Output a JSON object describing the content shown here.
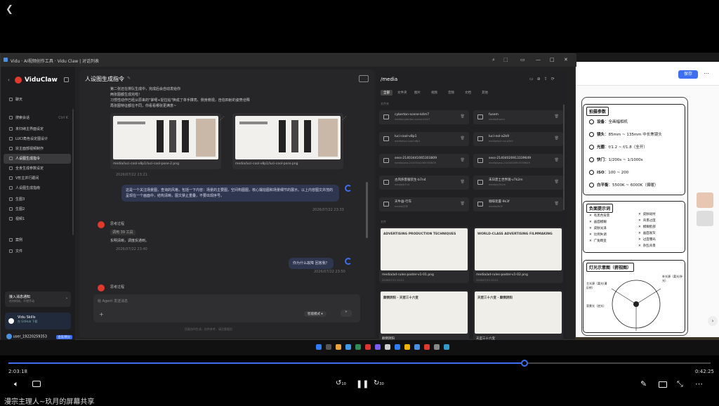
{
  "window": {
    "title": "Vidu · AI视频创作工具 · Vidu Claw | 对话列表"
  },
  "brand": "ViduClaw",
  "sidebar": {
    "items": [
      {
        "label": "聊天",
        "active": false
      },
      {
        "label": "搜索会话",
        "shortcut": "Ctrl K",
        "active": false
      },
      {
        "label": "未归纳主界面设定",
        "active": false
      },
      {
        "label": "LUCI角色设定图设计",
        "active": false
      },
      {
        "label": "宗主面部视频制作",
        "active": false
      },
      {
        "label": "人设图生成指令",
        "active": true
      },
      {
        "label": "全身生成参数设定",
        "active": false
      },
      {
        "label": "V形主并行跟间",
        "active": false
      },
      {
        "label": "人设图生成指南",
        "active": false
      },
      {
        "label": "生图3",
        "active": false
      },
      {
        "label": "生图2",
        "active": false
      },
      {
        "label": "视频1",
        "active": false
      },
      {
        "label": "案例",
        "active": false
      },
      {
        "label": "文件",
        "active": false
      }
    ],
    "notif_title": "接入消息通知",
    "notif_sub": "任何时间，不错手动",
    "skills_title": "Vidu Skills",
    "skills_sub": "在 GitHub 下载",
    "user": "user_19220259353",
    "user_badge": "会员/积分"
  },
  "chat": {
    "title": "人设图生成指令",
    "intro": [
      "第二张还在排队生成中，完成后会自动发给你",
      "两张图都生成完啦！",
      "习惯性动作已经从原来的\"掌噶+捉拉钻\"换成了单手撑亮、侧身俯视，自信四射的姿势诠释",
      "再张图特征都在不同，你看看哪张更满意~"
    ],
    "images": [
      {
        "caption": "media/luci-cool-v8p1/luci-cool-pose-2.png"
      },
      {
        "caption": "media/luci-cool-v8p1/luci-cool-pose.png"
      }
    ],
    "timestamp1": "2026/07/22 23:21",
    "user_msg": "这是一个关注场景图，查询的风格，包括一下内容：场景的主要图，空间构图图，核心摆拍图和场景细节的展示。以上内容图文并茂的呈现在一个画面中，结构清晰，图文禁止重叠，不要出现序号。",
    "user_time": "2026/07/22 23:33",
    "bot_name": "思考过程",
    "bot_status": "调用 39 工具",
    "bot_reply": "东明清晰，调度反通到。",
    "bot_time": "2026/07/22 23:40",
    "user_msg2": "你为什么故障 回答我？",
    "user_time2": "2026/07/22 23:50",
    "input_placeholder": "给 Agent 发送消息",
    "mode": "智能模式",
    "footer": "回复由AI生成，仅供参考，请注意甄别"
  },
  "media": {
    "path": "/media",
    "tabs": [
      "全部",
      "文件夹",
      "图片",
      "视频",
      "音频",
      "文档",
      "其他"
    ],
    "section_folders": "文件夹",
    "folders": [
      {
        "name": "cyberton-scene-k4m7",
        "sub": "media/cyberton-scene-k4m7"
      },
      {
        "name": "fusem",
        "sub": "media/fusem"
      },
      {
        "name": "luci-cool-v8p1",
        "sub": "media/luci-cool-v8p1"
      },
      {
        "name": "luci-nol-a2k9",
        "sub": "media/luci-nol-a2k9"
      },
      {
        "name": "sess-21403441065303809",
        "sub": "media/sess-21403441065303809"
      },
      {
        "name": "sess-21404026913339649",
        "sub": "media/sess-21404026913339649"
      },
      {
        "name": "古风侠客服装生-b7n4",
        "sub": "media/b7n4"
      },
      {
        "name": "末日废土世界观-v7k2m",
        "sub": "media/v7k2m"
      },
      {
        "name": "天牛画-行车",
        "sub": "media/行车"
      },
      {
        "name": "咖啡装置-9k3f",
        "sub": "media/9k3f"
      }
    ],
    "section_files": "文件",
    "files": [
      {
        "name": "media/ad-rules-poster-v1-01.png",
        "date": "2026/07/21 20:21",
        "title": "ADVERTISING PRODUCTION TECHNIQUES"
      },
      {
        "name": "media/ad-rules-poster-v1-02.png",
        "date": "2026/07/21 20:21",
        "title": "WORLD-CLASS ADVERTISING FILMMAKING"
      },
      {
        "name": "颠倒阴阳",
        "date": "",
        "title": "颠倒阴阳 · 天罡三十六变"
      },
      {
        "name": "天罡三十六变",
        "date": "",
        "title": "天罡三十六变 · 颠倒阴阳"
      }
    ]
  },
  "doc": {
    "save": "保存",
    "section1": "拍摄参数",
    "params": [
      {
        "k": "设备",
        "v": "全画幅相机"
      },
      {
        "k": "镜头",
        "v": "85mm ~ 135mm 中长焦镜头"
      },
      {
        "k": "光圈",
        "v": "f/1.2 ~ f/1.8（全开）"
      },
      {
        "k": "快门",
        "v": "1/200s ~ 1/1000s"
      },
      {
        "k": "ISO",
        "v": "100 ~ 200"
      },
      {
        "k": "白平衡",
        "v": "5500K ~ 6000K（偏暖）"
      }
    ],
    "section2": "负面提示词",
    "neg_left": [
      "有黑色背景",
      "画面模糊",
      "皮肤光泽",
      "比例失调",
      "广角畸变"
    ],
    "neg_right": [
      "皮肤斑纹",
      "背景过度",
      "模糊脸部",
      "画面发灰",
      "过度曝光",
      "杂乱背景"
    ],
    "section3": "灯光示意图（俯视图）",
    "light_labels": [
      "主光源（柔光/漫反射）",
      "补光源（柔光/补光）",
      "背景光（逆光）"
    ]
  },
  "player": {
    "current": "2:03:18",
    "total": "0:42:25",
    "progress": 0.735,
    "caption": "漫宗主理人~玖月的屏幕共享",
    "skip_back": "10",
    "skip_fwd": "30"
  },
  "colors": {
    "accent": "#3d6ff0",
    "brand": "#e0392d"
  }
}
